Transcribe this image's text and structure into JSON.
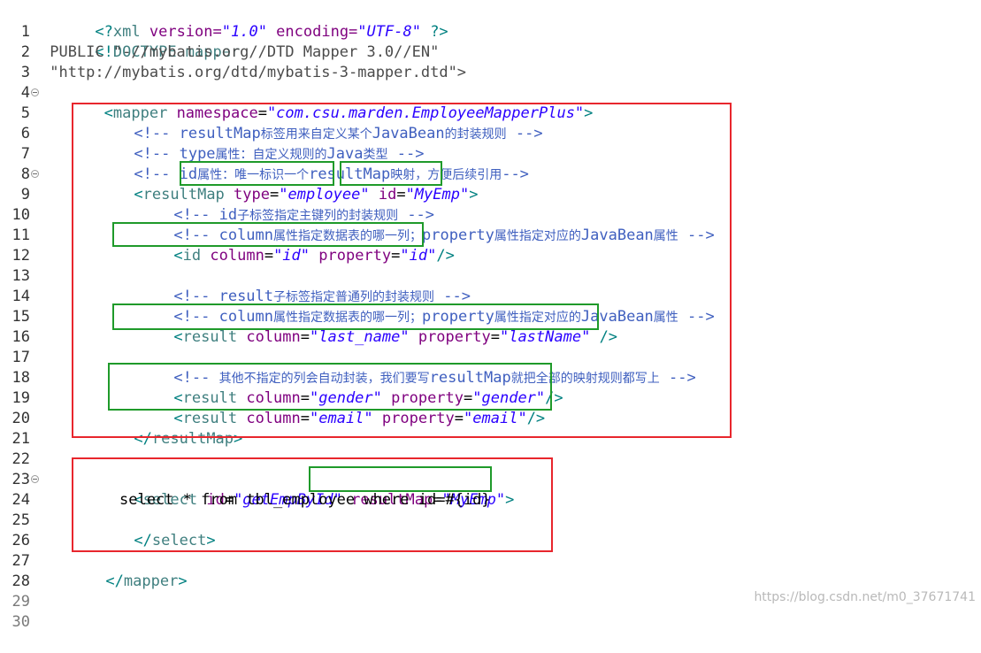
{
  "editor": {
    "line_numbers": [
      "1",
      "2",
      "3",
      "4",
      "5",
      "6",
      "7",
      "8",
      "9",
      "10",
      "11",
      "12",
      "13",
      "14",
      "15",
      "16",
      "17",
      "18",
      "19",
      "20",
      "21",
      "22",
      "23",
      "24",
      "25",
      "26",
      "27",
      "28",
      "29",
      "30"
    ],
    "lines": {
      "l1": {
        "p1": "<?",
        "p2": "xml",
        "p3": " version=",
        "p4": "\"1.0\"",
        "p5": " encoding=",
        "p6": "\"UTF-8\"",
        "p7": " ?>"
      },
      "l2": {
        "p1": "<!",
        "p2": "DOCTYPE mapper"
      },
      "l3": {
        "p1": " PUBLIC \"-//mybatis.org//DTD Mapper 3.0//EN\""
      },
      "l4": {
        "p1": " \"http://mybatis.org/dtd/mybatis-3-mapper.dtd\">"
      },
      "l5": {
        "p1": " <",
        "p2": "mapper",
        "p3": " namespace",
        "p4": "=",
        "p5": "\"com.csu.marden.EmployeeMapperPlus\"",
        "p6": ">"
      },
      "l6": {
        "p1": "<!-- resultMap",
        "p2": "标签用来自定义某个",
        "p3": "JavaBean",
        "p4": "的封装规则",
        "p5": " -->"
      },
      "l7": {
        "p1": "<!-- type",
        "p2": "属性：自定义规则的",
        "p3": "Java",
        "p4": "类型",
        "p5": " -->"
      },
      "l8": {
        "p1": "<!-- id",
        "p2": "属性：唯一标识一个",
        "p3": "resultMap",
        "p4": "映射，方便后续引用",
        "p5": "-->"
      },
      "l9": {
        "p1": "<",
        "p2": "resultMap",
        "p3": " type",
        "p4": "=",
        "p5": "\"employee\"",
        "p6": " id",
        "p7": "=",
        "p8": "\"MyEmp\"",
        "p9": ">"
      },
      "l10": {
        "p1": "<!-- id",
        "p2": "子标签指定主键列的封装规则",
        "p3": " -->"
      },
      "l11": {
        "p1": "<!-- column",
        "p2": "属性指定数据表的哪一列；",
        "p3": "property",
        "p4": "属性指定对应的",
        "p5": "JavaBean",
        "p6": "属性",
        "p7": " -->"
      },
      "l12": {
        "p1": "<",
        "p2": "id",
        "p3": " column",
        "p4": "=",
        "p5": "\"id\"",
        "p6": " property",
        "p7": "=",
        "p8": "\"id\"",
        "p9": "/>"
      },
      "l14": {
        "p1": "<!-- result",
        "p2": "子标签指定普通列的封装规则",
        "p3": " -->"
      },
      "l15": {
        "p1": "<!-- column",
        "p2": "属性指定数据表的哪一列；",
        "p3": "property",
        "p4": "属性指定对应的",
        "p5": "JavaBean",
        "p6": "属性",
        "p7": " -->"
      },
      "l16": {
        "p1": "<",
        "p2": "result",
        "p3": " column",
        "p4": "=",
        "p5": "\"last_name\"",
        "p6": " property",
        "p7": "=",
        "p8": "\"lastName\"",
        "p9": " />"
      },
      "l18": {
        "p1": "<!-- ",
        "p2": "其他不指定的列会自动封装，我们要写",
        "p3": "resultMap",
        "p4": "就把全部的映射规则都写上",
        "p5": " -->"
      },
      "l19": {
        "p1": "<",
        "p2": "result",
        "p3": " column",
        "p4": "=",
        "p5": "\"gender\"",
        "p6": " property",
        "p7": "=",
        "p8": "\"gender\"",
        "p9": "/>"
      },
      "l20": {
        "p1": "<",
        "p2": "result",
        "p3": " column",
        "p4": "=",
        "p5": "\"email\"",
        "p6": " property",
        "p7": "=",
        "p8": "\"email\"",
        "p9": "/>"
      },
      "l21": {
        "p1": "</",
        "p2": "resultMap",
        "p3": ">"
      },
      "l24": {
        "p1": "<",
        "p2": "select",
        "p3": " id",
        "p4": "=",
        "p5": "\"getEmpById\"",
        "p6": " resultMap",
        "p7": "=",
        "p8": "\"MyEmp\"",
        "p9": ">"
      },
      "l25": {
        "p1": "select * from tbl_employee where id=#{id}"
      },
      "l26": {
        "p1": "</",
        "p2": "select",
        "p3": ">"
      },
      "l28": {
        "p1": "</",
        "p2": "mapper",
        "p3": ">"
      }
    }
  },
  "watermark": "https://blog.csdn.net/m0_37671741",
  "colors": {
    "highlight_red": "#e8262d",
    "highlight_green": "#1f9a2a",
    "comment": "#3f5fbf",
    "string": "#2a00ff",
    "attribute": "#7f007f",
    "tag": "#3f7f7f"
  }
}
